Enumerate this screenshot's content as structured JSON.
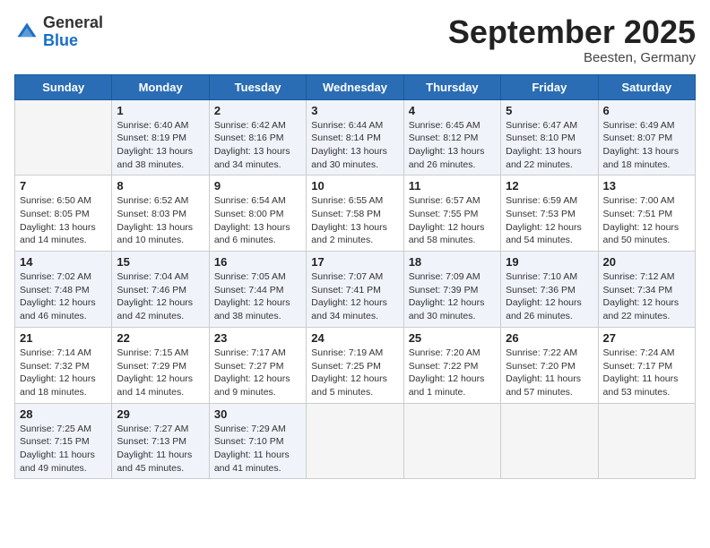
{
  "header": {
    "logo": {
      "general": "General",
      "blue": "Blue"
    },
    "title": "September 2025",
    "subtitle": "Beesten, Germany"
  },
  "days_of_week": [
    "Sunday",
    "Monday",
    "Tuesday",
    "Wednesday",
    "Thursday",
    "Friday",
    "Saturday"
  ],
  "weeks": [
    [
      {
        "day": "",
        "info": ""
      },
      {
        "day": "1",
        "info": "Sunrise: 6:40 AM\nSunset: 8:19 PM\nDaylight: 13 hours\nand 38 minutes."
      },
      {
        "day": "2",
        "info": "Sunrise: 6:42 AM\nSunset: 8:16 PM\nDaylight: 13 hours\nand 34 minutes."
      },
      {
        "day": "3",
        "info": "Sunrise: 6:44 AM\nSunset: 8:14 PM\nDaylight: 13 hours\nand 30 minutes."
      },
      {
        "day": "4",
        "info": "Sunrise: 6:45 AM\nSunset: 8:12 PM\nDaylight: 13 hours\nand 26 minutes."
      },
      {
        "day": "5",
        "info": "Sunrise: 6:47 AM\nSunset: 8:10 PM\nDaylight: 13 hours\nand 22 minutes."
      },
      {
        "day": "6",
        "info": "Sunrise: 6:49 AM\nSunset: 8:07 PM\nDaylight: 13 hours\nand 18 minutes."
      }
    ],
    [
      {
        "day": "7",
        "info": "Sunrise: 6:50 AM\nSunset: 8:05 PM\nDaylight: 13 hours\nand 14 minutes."
      },
      {
        "day": "8",
        "info": "Sunrise: 6:52 AM\nSunset: 8:03 PM\nDaylight: 13 hours\nand 10 minutes."
      },
      {
        "day": "9",
        "info": "Sunrise: 6:54 AM\nSunset: 8:00 PM\nDaylight: 13 hours\nand 6 minutes."
      },
      {
        "day": "10",
        "info": "Sunrise: 6:55 AM\nSunset: 7:58 PM\nDaylight: 13 hours\nand 2 minutes."
      },
      {
        "day": "11",
        "info": "Sunrise: 6:57 AM\nSunset: 7:55 PM\nDaylight: 12 hours\nand 58 minutes."
      },
      {
        "day": "12",
        "info": "Sunrise: 6:59 AM\nSunset: 7:53 PM\nDaylight: 12 hours\nand 54 minutes."
      },
      {
        "day": "13",
        "info": "Sunrise: 7:00 AM\nSunset: 7:51 PM\nDaylight: 12 hours\nand 50 minutes."
      }
    ],
    [
      {
        "day": "14",
        "info": "Sunrise: 7:02 AM\nSunset: 7:48 PM\nDaylight: 12 hours\nand 46 minutes."
      },
      {
        "day": "15",
        "info": "Sunrise: 7:04 AM\nSunset: 7:46 PM\nDaylight: 12 hours\nand 42 minutes."
      },
      {
        "day": "16",
        "info": "Sunrise: 7:05 AM\nSunset: 7:44 PM\nDaylight: 12 hours\nand 38 minutes."
      },
      {
        "day": "17",
        "info": "Sunrise: 7:07 AM\nSunset: 7:41 PM\nDaylight: 12 hours\nand 34 minutes."
      },
      {
        "day": "18",
        "info": "Sunrise: 7:09 AM\nSunset: 7:39 PM\nDaylight: 12 hours\nand 30 minutes."
      },
      {
        "day": "19",
        "info": "Sunrise: 7:10 AM\nSunset: 7:36 PM\nDaylight: 12 hours\nand 26 minutes."
      },
      {
        "day": "20",
        "info": "Sunrise: 7:12 AM\nSunset: 7:34 PM\nDaylight: 12 hours\nand 22 minutes."
      }
    ],
    [
      {
        "day": "21",
        "info": "Sunrise: 7:14 AM\nSunset: 7:32 PM\nDaylight: 12 hours\nand 18 minutes."
      },
      {
        "day": "22",
        "info": "Sunrise: 7:15 AM\nSunset: 7:29 PM\nDaylight: 12 hours\nand 14 minutes."
      },
      {
        "day": "23",
        "info": "Sunrise: 7:17 AM\nSunset: 7:27 PM\nDaylight: 12 hours\nand 9 minutes."
      },
      {
        "day": "24",
        "info": "Sunrise: 7:19 AM\nSunset: 7:25 PM\nDaylight: 12 hours\nand 5 minutes."
      },
      {
        "day": "25",
        "info": "Sunrise: 7:20 AM\nSunset: 7:22 PM\nDaylight: 12 hours\nand 1 minute."
      },
      {
        "day": "26",
        "info": "Sunrise: 7:22 AM\nSunset: 7:20 PM\nDaylight: 11 hours\nand 57 minutes."
      },
      {
        "day": "27",
        "info": "Sunrise: 7:24 AM\nSunset: 7:17 PM\nDaylight: 11 hours\nand 53 minutes."
      }
    ],
    [
      {
        "day": "28",
        "info": "Sunrise: 7:25 AM\nSunset: 7:15 PM\nDaylight: 11 hours\nand 49 minutes."
      },
      {
        "day": "29",
        "info": "Sunrise: 7:27 AM\nSunset: 7:13 PM\nDaylight: 11 hours\nand 45 minutes."
      },
      {
        "day": "30",
        "info": "Sunrise: 7:29 AM\nSunset: 7:10 PM\nDaylight: 11 hours\nand 41 minutes."
      },
      {
        "day": "",
        "info": ""
      },
      {
        "day": "",
        "info": ""
      },
      {
        "day": "",
        "info": ""
      },
      {
        "day": "",
        "info": ""
      }
    ]
  ]
}
